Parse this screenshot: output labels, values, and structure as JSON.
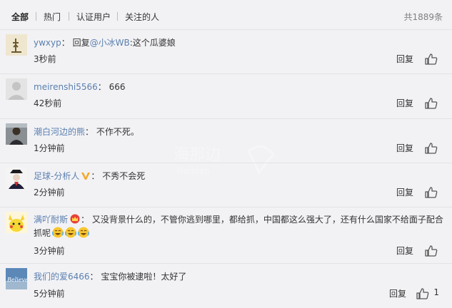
{
  "tabs": [
    {
      "label": "全部"
    },
    {
      "label": "热门"
    },
    {
      "label": "认证用户"
    },
    {
      "label": "关注的人"
    }
  ],
  "total_label": "共1889条",
  "reply_label": "回复",
  "like_icon": "thumbs-up-icon",
  "comments": [
    {
      "user": "ywxyp",
      "colon": "：",
      "prefix": "回复",
      "mention": "@小冰WB",
      "text": ":这个瓜婆娘",
      "time": "3秒前"
    },
    {
      "user": "meirenshi5566",
      "colon": "：",
      "text": "666",
      "time": "42秒前"
    },
    {
      "user": "潮白河边的熊",
      "colon": "：",
      "text": "不作不死。",
      "time": "1分钟前"
    },
    {
      "user": "足球-分析人",
      "colon": "：",
      "text": "不秀不会死",
      "time": "2分钟前",
      "badge": "v-badge-icon"
    },
    {
      "user": "满吖耐斯",
      "colon": "：",
      "text_line1": "又没背景什么的，不管你逃到哪里，都给抓，中国都这么强大了，还有什么国家不给面子配合",
      "text_line2": "抓呢",
      "time": "3分钟前",
      "badge": "crown-badge-icon",
      "emojis": [
        "laugh-cry-emoji-icon",
        "laugh-cry-emoji-icon",
        "laugh-cry-emoji-icon"
      ]
    },
    {
      "user": "我们的爱6466",
      "colon": "：",
      "text": "宝宝你被逮啦！太好了",
      "time": "5分钟前",
      "likes": "1"
    }
  ],
  "colors": {
    "link": "#5a7fae",
    "text": "#333333",
    "background": "#f2f2f5",
    "divider": "#e3e3e6"
  }
}
